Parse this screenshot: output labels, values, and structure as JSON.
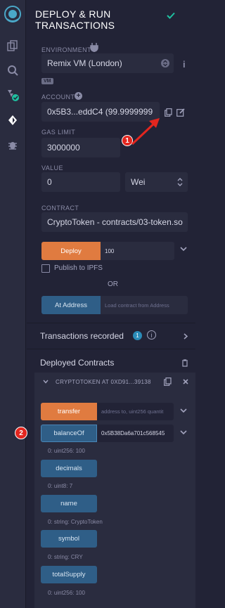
{
  "app": {
    "title": "DEPLOY & RUN TRANSACTIONS"
  },
  "environment": {
    "label": "ENVIRONMENT",
    "value": "Remix VM (London)",
    "tag": "VM"
  },
  "account": {
    "label": "ACCOUNT",
    "value": "0x5B3...eddC4 (99.9999999"
  },
  "gas_limit": {
    "label": "GAS LIMIT",
    "value": "3000000"
  },
  "value": {
    "label": "VALUE",
    "amount": "0",
    "unit": "Wei"
  },
  "contract": {
    "label": "CONTRACT",
    "value": "CryptoToken - contracts/03-token.so"
  },
  "deploy": {
    "button": "Deploy",
    "arg": "100",
    "publish": "Publish to IPFS",
    "or": "OR"
  },
  "at_address": {
    "button": "At Address",
    "placeholder": "Load contract from Address"
  },
  "transactions": {
    "label": "Transactions recorded",
    "count": "1"
  },
  "deployed": {
    "label": "Deployed Contracts",
    "instance": "CRYPTOTOKEN AT 0XD91...39138",
    "functions": [
      {
        "name": "transfer",
        "arg": "address to, uint256 quantit",
        "result": ""
      },
      {
        "name": "balanceOf",
        "arg": "0x5B38Da6a701c568545",
        "result": "0: uint256: 100"
      },
      {
        "name": "decimals",
        "arg": "",
        "result": "0: uint8: 7"
      },
      {
        "name": "name",
        "arg": "",
        "result": "0: string: CryptoToken"
      },
      {
        "name": "symbol",
        "arg": "",
        "result": "0: string: CRY"
      },
      {
        "name": "totalSupply",
        "arg": "",
        "result": "0: uint256: 100"
      }
    ]
  },
  "annotations": {
    "marker1": "1",
    "marker2": "2"
  },
  "colors": {
    "accent": "#e07b40",
    "call_button": "#2f5e87",
    "marker": "#e3261f",
    "check": "#1fc0a0"
  }
}
